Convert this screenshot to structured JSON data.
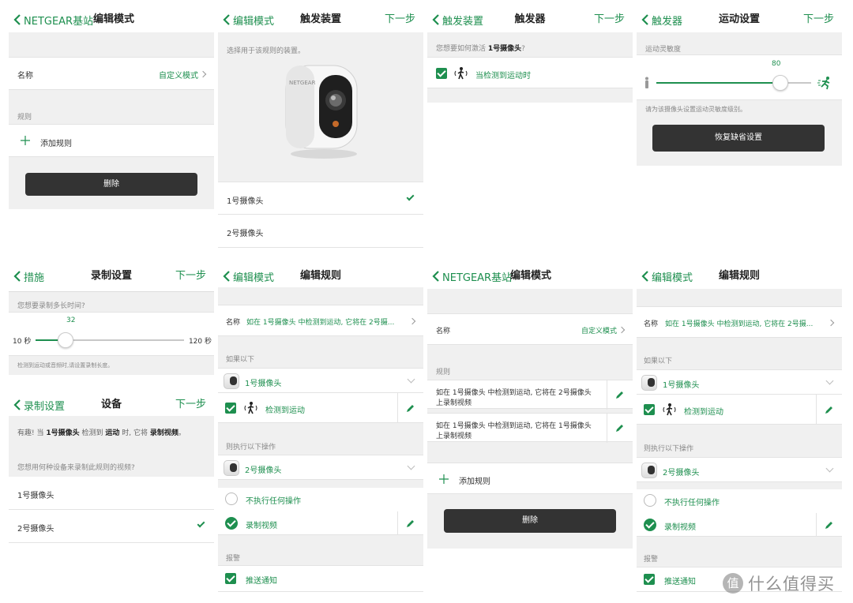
{
  "colors": {
    "accent": "#1e8f4f",
    "dark_button": "#333333",
    "background": "#f0f0f0"
  },
  "p1": {
    "back": "NETGEAR基站",
    "title": "编辑模式",
    "name_label": "名称",
    "name_value": "自定义模式",
    "rules_header": "规则",
    "add_rule": "添加规则",
    "delete": "删除"
  },
  "p2": {
    "back": "编辑模式",
    "title": "触发装置",
    "next": "下一步",
    "prompt": "选择用于该规则的装置。",
    "brand": "NETGEAR",
    "devices": [
      "1号摄像头",
      "2号摄像头"
    ]
  },
  "p3": {
    "back": "触发装置",
    "title": "触发器",
    "next": "下一步",
    "question_pre": "您想要如何激活",
    "question_cam": "1号摄像头",
    "question_post": "?",
    "option": "当检测到运动时"
  },
  "p4": {
    "back": "触发器",
    "title": "运动设置",
    "next": "下一步",
    "sensitivity_label": "运动灵敏度",
    "value": "80",
    "slider_fraction": 0.8,
    "hint": "请为该摄像头设置运动灵敏度级别。",
    "reset": "恢复缺省设置"
  },
  "p5": {
    "back": "措施",
    "title": "录制设置",
    "next": "下一步",
    "question": "您想要录制多长时间?",
    "value": "32",
    "min": "10 秒",
    "max": "120 秒",
    "slider_fraction": 0.2,
    "hint": "检测到运动或音频时,请设置录制长度。"
  },
  "p6": {
    "back": "录制设置",
    "title": "设备",
    "next": "下一步",
    "info_a": "有趣! 当",
    "info_b": "1号摄像头",
    "info_c": "检测到",
    "info_d": "运动",
    "info_e": "时, 它将",
    "info_f": "录制视频",
    "info_g": "。",
    "question": "您想用何种设备来录制此规则的视频?",
    "devices": [
      "1号摄像头",
      "2号摄像头"
    ]
  },
  "p7": {
    "back": "编辑模式",
    "title": "编辑规则",
    "name_label": "名称",
    "name_value": "如在 1号摄像头 中检测到运动, 它将在 2号摄...",
    "if_header": "如果以下",
    "trigger_cam": "1号摄像头",
    "trigger_event": "检测到运动",
    "then_header": "则执行以下操作",
    "action_cam": "2号摄像头",
    "action_none": "不执行任何操作",
    "action_record": "录制视频",
    "alert_header": "报警",
    "push": "推送通知"
  },
  "p8": {
    "back": "NETGEAR基站",
    "title": "编辑模式",
    "name_label": "名称",
    "name_value": "自定义模式",
    "rules_header": "规则",
    "rule1_line1": "如在 1号摄像头 中检测到运动, 它将在 2号摄像头",
    "rule1_line2": "上录制视频",
    "rule2_line1": "如在 1号摄像头 中检测到运动, 它将在 1号摄像头",
    "rule2_line2": "上录制视频",
    "add_rule": "添加规则",
    "delete": "删除"
  },
  "p9": {
    "back": "编辑模式",
    "title": "编辑规则",
    "name_label": "名称",
    "name_value": "如在 1号摄像头 中检测到运动, 它将在 2号摄...",
    "if_header": "如果以下",
    "trigger_cam": "1号摄像头",
    "trigger_event": "检测到运动",
    "then_header": "则执行以下操作",
    "action_cam": "2号摄像头",
    "action_none": "不执行任何操作",
    "action_record": "录制视频",
    "alert_header": "报警",
    "push": "推送通知"
  },
  "watermark": {
    "text": "什么值得买",
    "logo_glyph": "值"
  }
}
